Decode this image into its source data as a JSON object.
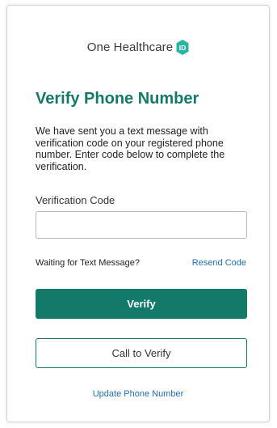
{
  "brand": {
    "name": "One Healthcare",
    "badge_text": "ID",
    "color": "#137a6a"
  },
  "page": {
    "title": "Verify Phone Number",
    "description": "We have sent you a text message with verification code on your registered phone number. Enter code below to complete the verification."
  },
  "form": {
    "code_label": "Verification Code",
    "code_value": "",
    "code_placeholder": ""
  },
  "status": {
    "waiting_text": "Waiting for Text Message?",
    "resend_label": "Resend Code"
  },
  "actions": {
    "verify_label": "Verify",
    "call_label": "Call to Verify",
    "update_label": "Update Phone Number"
  },
  "colors": {
    "accent": "#137a6a",
    "link": "#1c6fb8"
  }
}
